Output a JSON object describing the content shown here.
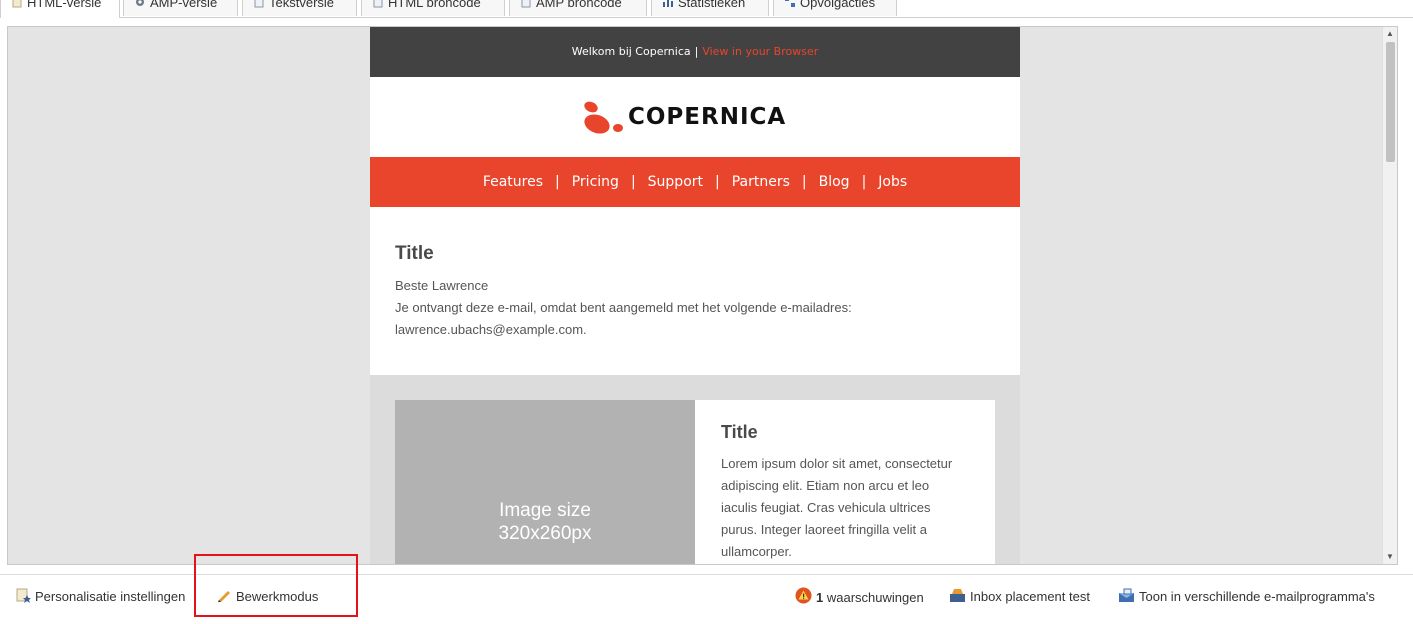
{
  "tabs": [
    {
      "label": "HTML-versie",
      "icon": "document-icon",
      "active": true
    },
    {
      "label": "AMP-versie",
      "icon": "gear-icon"
    },
    {
      "label": "Tekstversie",
      "icon": "text-document-icon"
    },
    {
      "label": "HTML broncode",
      "icon": "code-document-icon"
    },
    {
      "label": "AMP broncode",
      "icon": "code-document-icon"
    },
    {
      "label": "Statistieken",
      "icon": "bar-chart-icon"
    },
    {
      "label": "Opvolgacties",
      "icon": "flow-icon"
    }
  ],
  "email": {
    "topbar": {
      "welcome": "Welkom bij Copernica",
      "separator": "|",
      "view_link": "View in your Browser"
    },
    "logo_text": "COPERNICA",
    "nav": [
      "Features",
      "Pricing",
      "Support",
      "Partners",
      "Blog",
      "Jobs"
    ],
    "nav_separator": "|",
    "intro": {
      "title": "Title",
      "greeting": "Beste Lawrence",
      "body_line1": "Je ontvangt deze e-mail, omdat bent aangemeld met het volgende e-mailadres:",
      "email": "lawrence.ubachs@example.com."
    },
    "image_placeholder": {
      "line1": "Image size",
      "line2": "320x260px"
    },
    "card": {
      "title": "Title",
      "lines": [
        "Lorem ipsum dolor sit amet, consectetur",
        "adipiscing elit. Etiam non arcu et leo",
        "iaculis feugiat. Cras vehicula ultrices",
        "purus. Integer laoreet fringilla velit a",
        "ullamcorper."
      ]
    }
  },
  "toolbar": {
    "personalisation": "Personalisatie instellingen",
    "edit_mode": "Bewerkmodus",
    "warnings_count": "1",
    "warnings_label": "waarschuwingen",
    "inbox_test": "Inbox placement test",
    "show_in_clients": "Toon in verschillende e-mailprogramma's"
  },
  "colors": {
    "accent": "#e8452c",
    "topbar": "#424242",
    "highlight": "#e3131a"
  }
}
